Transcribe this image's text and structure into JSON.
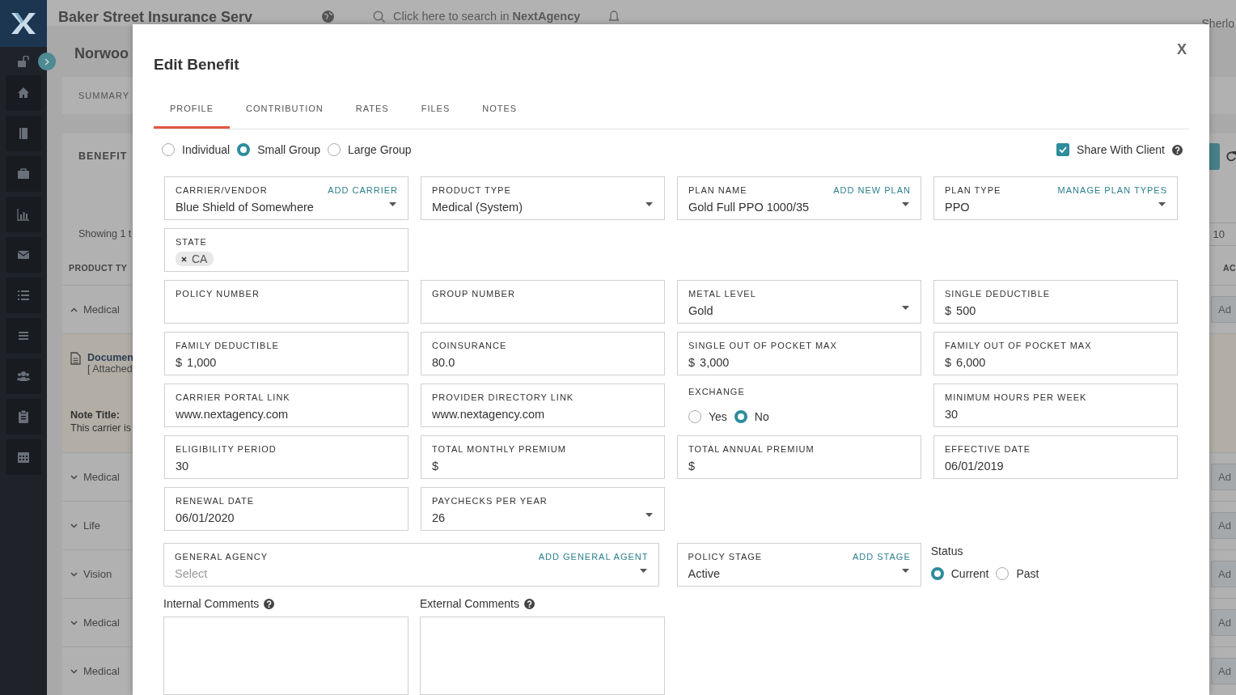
{
  "app_header": {
    "title": "Baker Street Insurance Serv",
    "search_placeholder": "Click here to search in **NextAgency**",
    "user": "Sherlo"
  },
  "page": {
    "title": "Norwoo",
    "tabs": [
      "SUMMARY"
    ]
  },
  "benefits": {
    "title": "BENEFIT",
    "showing": "Showing 1 t",
    "page_size": "10",
    "columns": [
      "PRODUCT TY",
      "AC"
    ],
    "rows": [
      {
        "label": "Medical",
        "expanded": true,
        "action": "Ad",
        "document": {
          "title": "Documen",
          "subtitle": "[ Attached"
        },
        "note": {
          "title": "Note Title:",
          "text": "This carrier is"
        }
      },
      {
        "label": "Medical",
        "expanded": false,
        "action": "Ad"
      },
      {
        "label": "Life",
        "expanded": false,
        "action": "Ad"
      },
      {
        "label": "Vision",
        "expanded": false,
        "action": "Ad"
      },
      {
        "label": "Medical",
        "expanded": false,
        "action": "Ad"
      },
      {
        "label": "Medical",
        "expanded": false,
        "action": "Ad"
      }
    ]
  },
  "modal": {
    "title": "Edit Benefit",
    "close": "X",
    "tabs": [
      {
        "label": "PROFILE",
        "selected": true
      },
      {
        "label": "CONTRIBUTION",
        "selected": false
      },
      {
        "label": "RATES",
        "selected": false
      },
      {
        "label": "FILES",
        "selected": false
      },
      {
        "label": "NOTES",
        "selected": false
      }
    ],
    "group_type": [
      {
        "label": "Individual",
        "selected": false
      },
      {
        "label": "Small Group",
        "selected": true
      },
      {
        "label": "Large Group",
        "selected": false
      }
    ],
    "share_with_client": {
      "label": "Share With Client",
      "checked": true
    },
    "field_rows": [
      [
        {
          "kind": "select",
          "label": "CARRIER/VENDOR",
          "action": "ADD CARRIER",
          "value": "Blue Shield of Somewhere"
        },
        {
          "kind": "select",
          "label": "PRODUCT TYPE",
          "value": "Medical (System)"
        },
        {
          "kind": "select",
          "label": "PLAN NAME",
          "action": "ADD NEW PLAN",
          "value": "Gold Full PPO 1000/35"
        },
        {
          "kind": "select",
          "label": "PLAN TYPE",
          "action": "MANAGE PLAN TYPES",
          "value": "PPO"
        }
      ],
      [
        {
          "kind": "tags",
          "label": "STATE",
          "tags": [
            "CA"
          ]
        }
      ],
      [
        {
          "kind": "text",
          "label": "POLICY NUMBER"
        },
        {
          "kind": "text",
          "label": "GROUP NUMBER"
        },
        {
          "kind": "select",
          "label": "METAL LEVEL",
          "value": "Gold"
        },
        {
          "kind": "text",
          "label": "SINGLE DEDUCTIBLE",
          "prefix": "$",
          "value": "500"
        }
      ],
      [
        {
          "kind": "text",
          "label": "FAMILY DEDUCTIBLE",
          "prefix": "$",
          "value": "1,000"
        },
        {
          "kind": "text",
          "label": "COINSURANCE",
          "value": "80.0"
        },
        {
          "kind": "text",
          "label": "SINGLE OUT OF POCKET MAX",
          "prefix": "$",
          "value": "3,000"
        },
        {
          "kind": "text",
          "label": "FAMILY OUT OF POCKET MAX",
          "prefix": "$",
          "value": "6,000"
        }
      ],
      [
        {
          "kind": "text",
          "label": "CARRIER PORTAL LINK",
          "value": "www.nextagency.com"
        },
        {
          "kind": "text",
          "label": "PROVIDER DIRECTORY LINK",
          "value": "www.nextagency.com"
        },
        {
          "kind": "radio",
          "label": "EXCHANGE",
          "options": [
            {
              "label": "Yes",
              "selected": false
            },
            {
              "label": "No",
              "selected": true
            }
          ]
        },
        {
          "kind": "text",
          "label": "MINIMUM HOURS PER WEEK",
          "value": "30"
        }
      ],
      [
        {
          "kind": "text",
          "label": "ELIGIBILITY PERIOD",
          "value": "30"
        },
        {
          "kind": "text",
          "label": "TOTAL MONTHLY PREMIUM",
          "prefix": "$"
        },
        {
          "kind": "text",
          "label": "TOTAL ANNUAL PREMIUM",
          "prefix": "$"
        },
        {
          "kind": "text",
          "label": "EFFECTIVE DATE",
          "value": "06/01/2019"
        }
      ],
      [
        {
          "kind": "text",
          "label": "RENEWAL DATE",
          "value": "06/01/2020"
        },
        {
          "kind": "select",
          "label": "PAYCHECKS PER YEAR",
          "value": "26"
        }
      ]
    ],
    "general_agency": {
      "kind": "select",
      "label": "GENERAL AGENCY",
      "action": "ADD GENERAL AGENT",
      "placeholder": "Select"
    },
    "policy_stage": {
      "kind": "select",
      "label": "POLICY STAGE",
      "action": "ADD STAGE",
      "value": "Active"
    },
    "status": {
      "label": "Status",
      "options": [
        {
          "label": "Current",
          "selected": true
        },
        {
          "label": "Past",
          "selected": false
        }
      ]
    },
    "comments": [
      {
        "label": "Internal Comments"
      },
      {
        "label": "External Comments"
      }
    ]
  }
}
